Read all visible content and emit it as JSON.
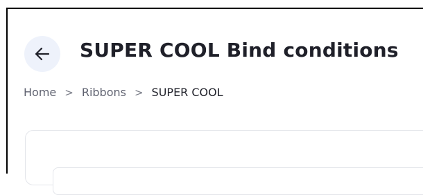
{
  "header": {
    "title": "SUPER COOL Bind conditions",
    "back_icon": "arrow-left-icon"
  },
  "breadcrumb": {
    "items": [
      "Home",
      "Ribbons",
      "SUPER COOL"
    ],
    "separator": ">"
  },
  "colors": {
    "back_button_bg": "#eef2fb",
    "title_text": "#1f2029",
    "muted_text": "#5f6270",
    "border": "#e3e5ea"
  }
}
